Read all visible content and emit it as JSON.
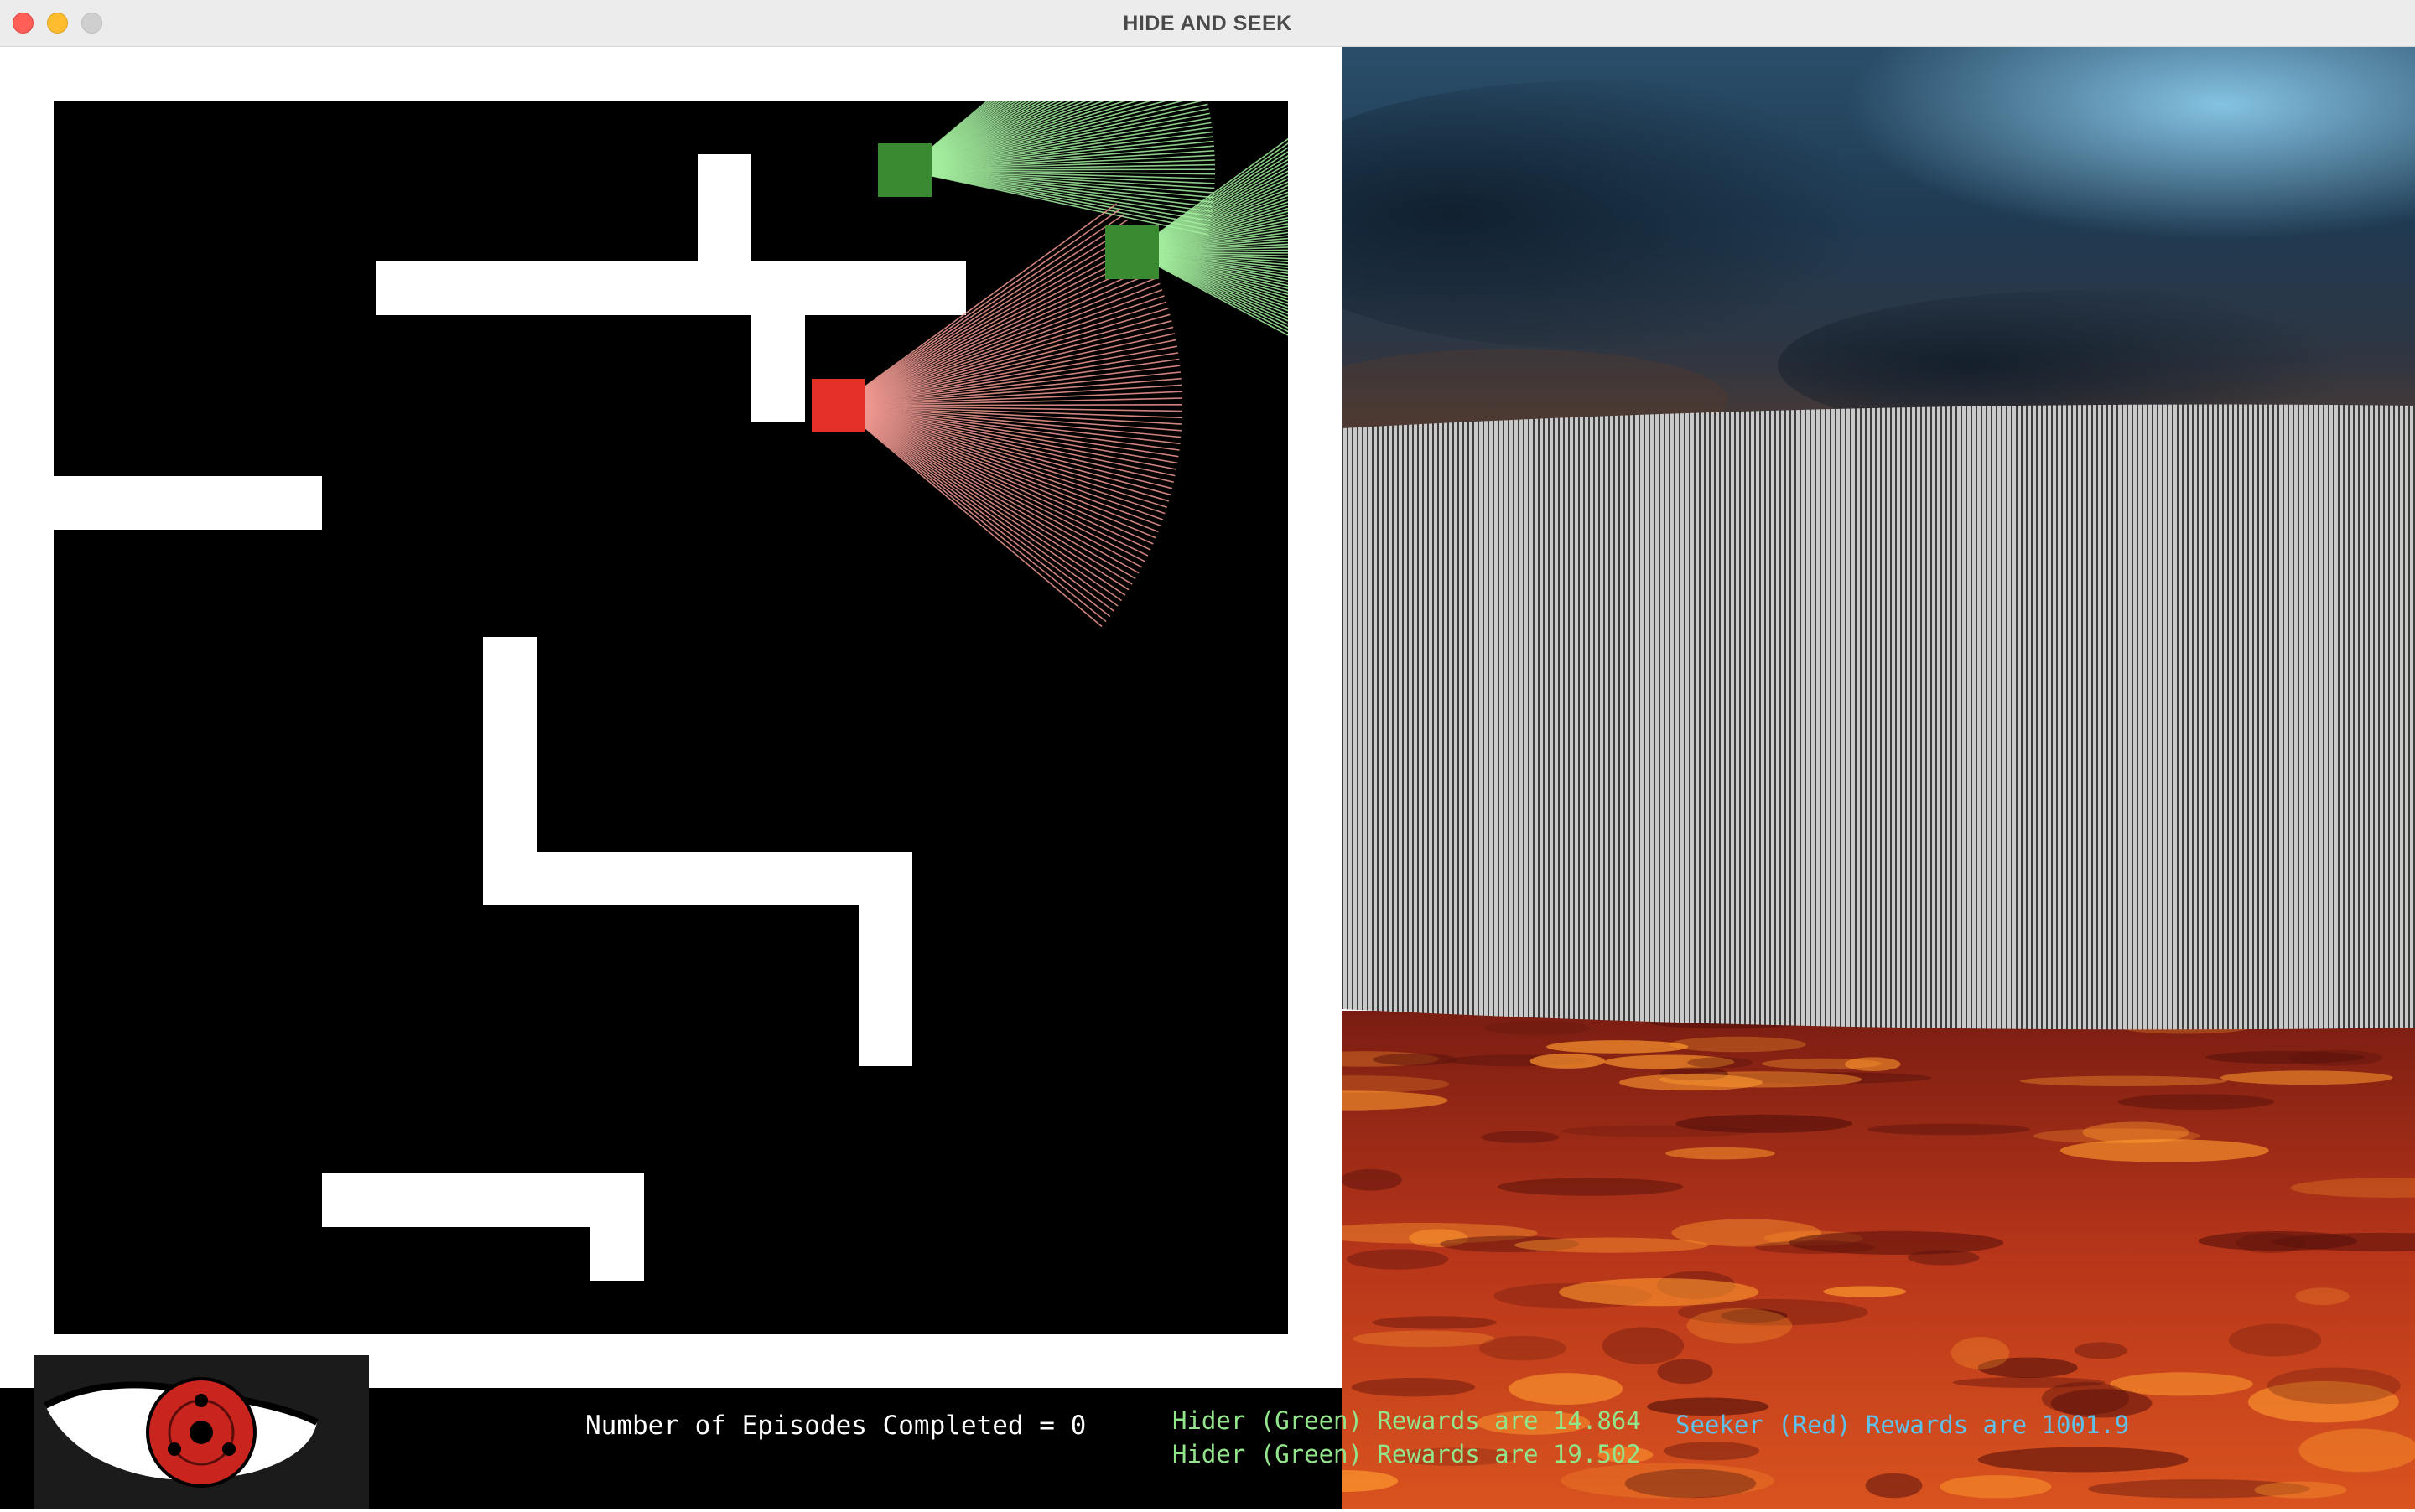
{
  "window": {
    "title": "HIDE AND SEEK",
    "buttons": [
      "close-button",
      "minimize-button",
      "zoom-button"
    ]
  },
  "colors": {
    "hider": "#3a8a32",
    "hider_cone": "#a5f0a0",
    "seeker": "#e5302a",
    "seeker_cone": "#f29a93",
    "wall": "#ffffff",
    "arena": "#000000"
  },
  "arena": {
    "walls": [
      {
        "label": "wall-1"
      },
      {
        "label": "wall-2"
      },
      {
        "label": "wall-3"
      },
      {
        "label": "wall-4"
      },
      {
        "label": "wall-5"
      },
      {
        "label": "wall-6"
      },
      {
        "label": "wall-7"
      },
      {
        "label": "wall-8"
      },
      {
        "label": "wall-9"
      },
      {
        "label": "wall-10"
      }
    ],
    "agents": [
      {
        "role": "hider",
        "icon": "green-square-icon"
      },
      {
        "role": "hider",
        "icon": "green-square-icon"
      },
      {
        "role": "seeker",
        "icon": "red-square-icon"
      }
    ]
  },
  "view3d": {
    "sky": "stormy-sky",
    "wall": "striped-wall",
    "floor": "lava-floor"
  },
  "hud": {
    "logo_icon": "sharingan-eye-icon",
    "episodes_text": "Number of Episodes Completed  = 0",
    "hider_rewards": [
      "Hider (Green) Rewards are 14.864",
      "Hider (Green) Rewards are 19.502"
    ],
    "seeker_rewards": "Seeker (Red) Rewards are 1001.9"
  }
}
